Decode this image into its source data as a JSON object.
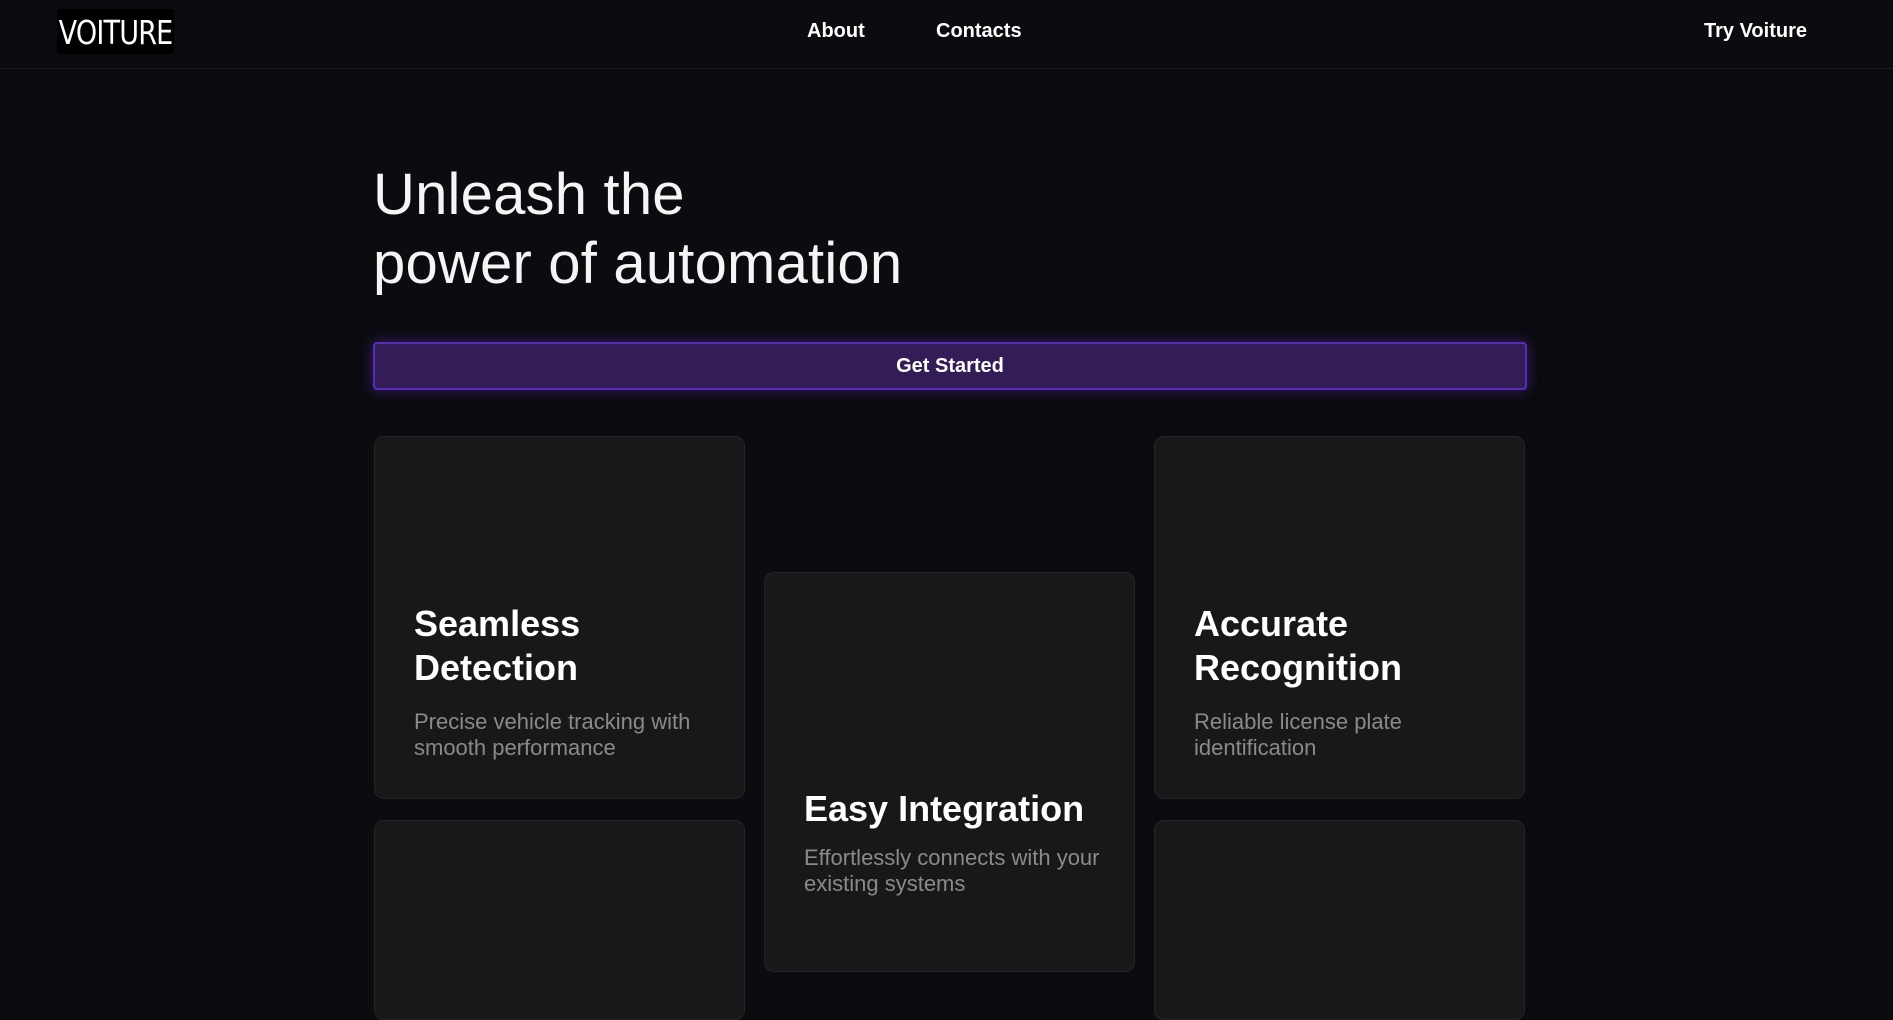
{
  "header": {
    "logo": "VOITURE",
    "nav": {
      "about": "About",
      "contacts": "Contacts"
    },
    "try_label": "Try Voiture"
  },
  "hero": {
    "title_line1": "Unleash the",
    "title_line2": "power of automation",
    "cta_label": "Get Started"
  },
  "features": [
    {
      "title": "Seamless Detection",
      "description": "Precise vehicle tracking with smooth performance"
    },
    {
      "title": "Easy Integration",
      "description": "Effortlessly connects with your existing systems"
    },
    {
      "title": "Accurate Recognition",
      "description": "Reliable license plate identification"
    }
  ],
  "colors": {
    "background": "#0b0b10",
    "card": "#181818",
    "accent": "#5a2bb8",
    "cta_fill": "#331d57"
  }
}
